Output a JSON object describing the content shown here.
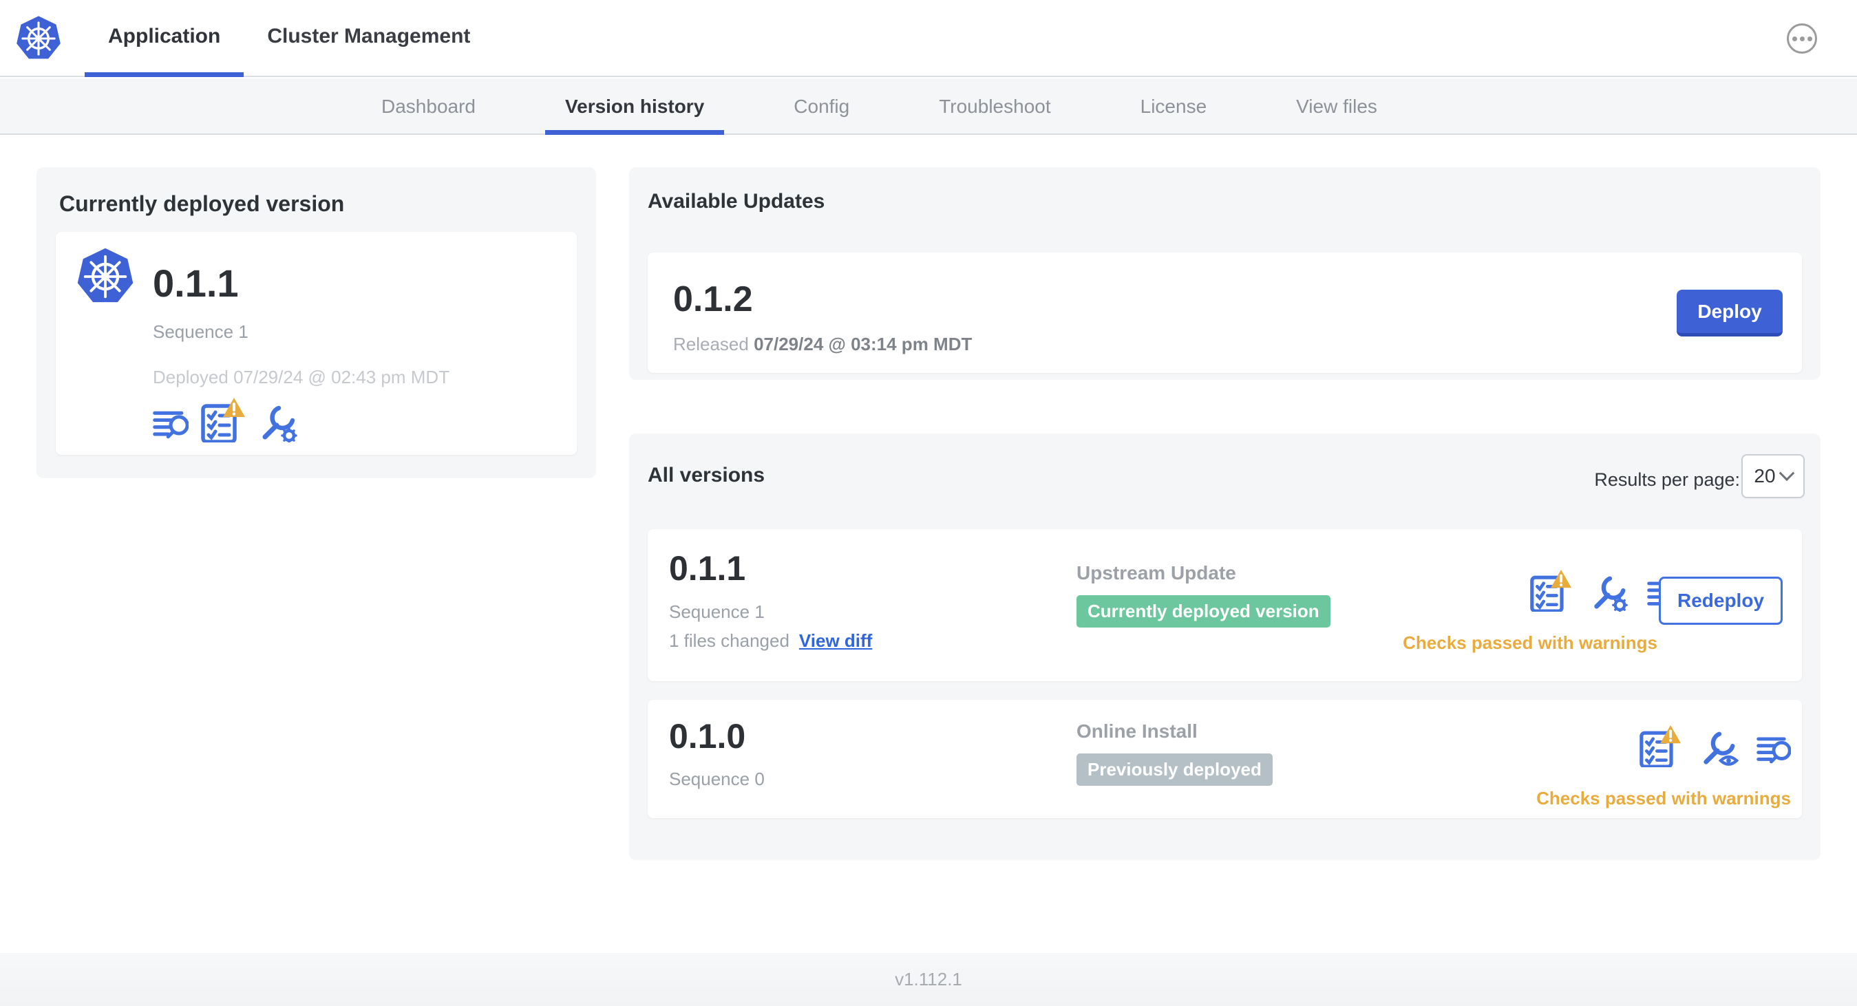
{
  "header": {
    "tabs": {
      "application": "Application",
      "cluster_management": "Cluster Management"
    }
  },
  "subnav": {
    "tabs": {
      "dashboard": "Dashboard",
      "version_history": "Version history",
      "config": "Config",
      "troubleshoot": "Troubleshoot",
      "license": "License",
      "view_files": "View files"
    },
    "active": "Version history"
  },
  "current_version_card": {
    "title": "Currently deployed version",
    "version": "0.1.1",
    "sequence": "Sequence 1",
    "deployed": "Deployed 07/29/24 @ 02:43 pm MDT"
  },
  "available_updates": {
    "title": "Available Updates",
    "version": "0.1.2",
    "released_prefix": "Released ",
    "released_date": "07/29/24 @ 03:14 pm MDT",
    "deploy_label": "Deploy"
  },
  "all_versions": {
    "title": "All versions",
    "results_per_page_label": "Results per page:",
    "results_per_page_value": "20",
    "rows": [
      {
        "version": "0.1.1",
        "sequence": "Sequence 1",
        "files_changed": "1 files changed",
        "view_diff_label": "View diff",
        "source": "Upstream Update",
        "badge": "Currently deployed version",
        "status": "Checks passed with warnings",
        "action_label": "Redeploy"
      },
      {
        "version": "0.1.0",
        "sequence": "Sequence 0",
        "source": "Online Install",
        "badge": "Previously deployed",
        "status": "Checks passed with warnings"
      }
    ]
  },
  "footer": {
    "app_version": "v1.112.1"
  },
  "colors": {
    "primary_blue": "#3e61d6",
    "icon_blue": "#4272e0",
    "link_blue": "#3066dc",
    "badge_green": "#6cc79e",
    "badge_gray": "#b4bfc6",
    "warning_amber": "#e8ac3e",
    "panel_gray": "#f4f6f8"
  }
}
